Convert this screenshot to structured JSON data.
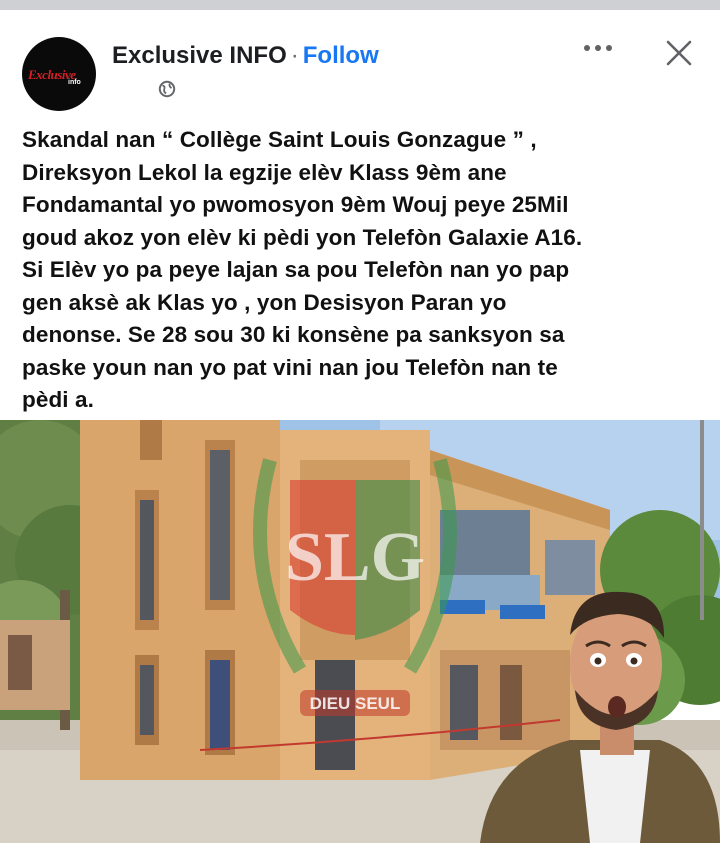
{
  "header": {
    "avatar_text": "Exclusive",
    "avatar_sub": "info",
    "page_name": "Exclusive INFO",
    "separator": "·",
    "follow_label": "Follow",
    "audience_icon": "globe-icon",
    "more_icon": "more-horizontal-icon",
    "close_icon": "close-icon"
  },
  "post": {
    "text": "Skandal nan “ Collège Saint Louis Gonzague ” ,\nDireksyon Lekol la egzije elèv Klass 9èm ane\nFondamantal yo pwomosyon 9èm Wouj peye 25Mil\ngoud akoz yon elèv ki pèdi yon Telefòn Galaxie A16.\nSi Elèv yo pa peye lajan sa pou Telefòn nan yo pap\ngen aksè ak Klas yo , yon Desisyon Paran yo\ndenonse. Se 28 sou 30 ki konsène pa sanksyon sa\npaske youn nan yo pat vini nan jou Telefòn nan te\npèdi a."
  },
  "photo": {
    "watermark_letters": "SLG",
    "watermark_motto": "DIEU SEUL"
  },
  "colors": {
    "follow": "#1877f2",
    "text": "#111111",
    "building": "#d9a56a",
    "sky": "#9ec3e6"
  }
}
